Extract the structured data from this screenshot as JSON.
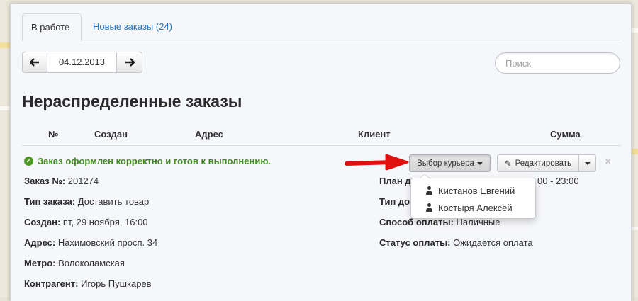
{
  "tabs": [
    {
      "label": "В работе"
    },
    {
      "label": "Новые заказы (24)"
    }
  ],
  "date_nav": {
    "date": "04.12.2013",
    "prev_icon": "arrow-left-icon",
    "next_icon": "arrow-right-icon"
  },
  "search": {
    "placeholder": "Поиск",
    "value": ""
  },
  "page_title": "Нераспределенные заказы",
  "table": {
    "columns": [
      "№",
      "Создан",
      "Адрес",
      "Клиент",
      "Сумма"
    ]
  },
  "order": {
    "status_message": "Заказ оформлен корректно и готов к выполнению.",
    "left_fields": [
      {
        "label": "Заказ №:",
        "value": " 201274"
      },
      {
        "label": "Тип заказа:",
        "value": " Доставить товар"
      },
      {
        "label": "Создан:",
        "value": " пт, 29 ноября, 16:00"
      },
      {
        "label": "Адрес:",
        "value": " Нахимовский просп. 34"
      },
      {
        "label": "Метро:",
        "value": " Волоколамская"
      },
      {
        "label": "Контрагент:",
        "value": " Игорь Пушкарев"
      }
    ],
    "right_fields": [
      {
        "label": "План д",
        "value": "00 - 23:00"
      },
      {
        "label": "Тип до",
        "value": ""
      },
      {
        "label": "Способ оплаты:",
        "value": " Наличные"
      },
      {
        "label": "Статус оплаты:",
        "value": " Ожидается оплата"
      }
    ]
  },
  "actions": {
    "courier_button": "Выбор курьера",
    "edit_button": "Редактировать",
    "close": "×"
  },
  "courier_dropdown": {
    "items": [
      "Кистанов Евгений",
      "Костыря Алексей"
    ]
  },
  "colors": {
    "link": "#1e74c6",
    "success": "#3f8a1f",
    "arrow": "#e01010"
  }
}
